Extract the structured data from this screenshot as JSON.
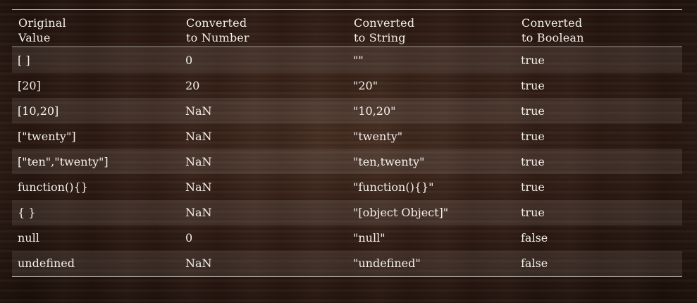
{
  "table": {
    "headers": [
      [
        "Original",
        "Value"
      ],
      [
        "Converted",
        "to Number"
      ],
      [
        "Converted",
        "to String"
      ],
      [
        "Converted",
        "to Boolean"
      ]
    ],
    "rows": [
      [
        "[ ]",
        "0",
        "\"\"",
        "true"
      ],
      [
        "[20]",
        "20",
        "\"20\"",
        "true"
      ],
      [
        "[10,20]",
        "NaN",
        "\"10,20\"",
        "true"
      ],
      [
        "[\"twenty\"]",
        "NaN",
        "\"twenty\"",
        "true"
      ],
      [
        "[\"ten\",\"twenty\"]",
        "NaN",
        "\"ten,twenty\"",
        "true"
      ],
      [
        "function(){}",
        "NaN",
        "\"function(){}\"",
        "true"
      ],
      [
        "{ }",
        "NaN",
        "\"[object Object]\"",
        "true"
      ],
      [
        "null",
        "0",
        "\"null\"",
        "false"
      ],
      [
        "undefined",
        "NaN",
        "\"undefined\"",
        "false"
      ]
    ]
  }
}
